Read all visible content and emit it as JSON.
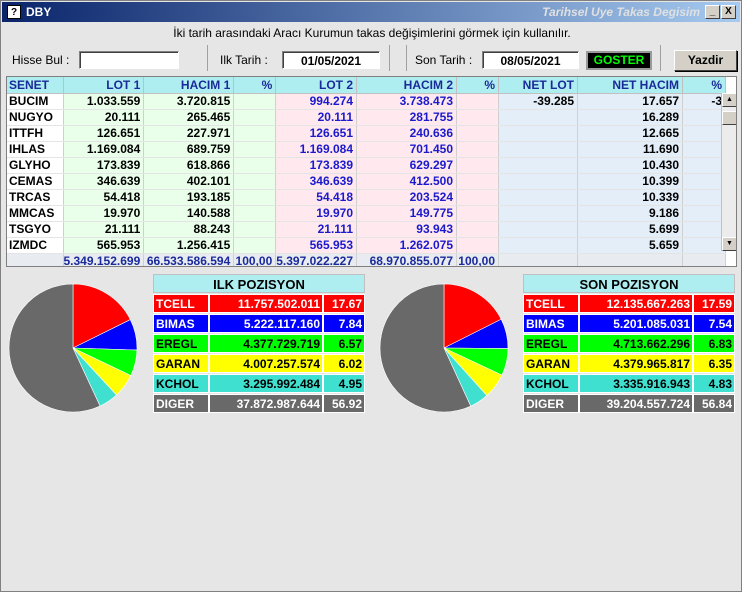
{
  "window": {
    "app_name": "DBY",
    "title": "Tarihsel Uye Takas Degisim",
    "min_glyph": "_",
    "close_glyph": "X"
  },
  "info_text": "İki tarih arasındaki  Aracı Kurumun takas değişimlerini görmek için kullanılır.",
  "toolbar": {
    "hisse_label": "Hisse Bul :",
    "hisse_value": "",
    "ilk_label": "Ilk Tarih :",
    "ilk_value": "01/05/2021",
    "son_label": "Son Tarih :",
    "son_value": "08/05/2021",
    "goster_label": "GOSTER",
    "yazdir_label": "Yazdir"
  },
  "table": {
    "headers": [
      "SENET",
      "LOT 1",
      "HACIM 1",
      "%",
      "LOT 2",
      "HACIM 2",
      "%",
      "NET LOT",
      "NET HACIM",
      "%"
    ],
    "rows": [
      [
        "BUCIM",
        "1.033.559",
        "3.720.815",
        "",
        "994.274",
        "3.738.473",
        "",
        "-39.285",
        "17.657",
        "-3"
      ],
      [
        "NUGYO",
        "20.111",
        "265.465",
        "",
        "20.111",
        "281.755",
        "",
        "",
        "16.289",
        ""
      ],
      [
        "ITTFH",
        "126.651",
        "227.971",
        "",
        "126.651",
        "240.636",
        "",
        "",
        "12.665",
        ""
      ],
      [
        "IHLAS",
        "1.169.084",
        "689.759",
        "",
        "1.169.084",
        "701.450",
        "",
        "",
        "11.690",
        ""
      ],
      [
        "GLYHO",
        "173.839",
        "618.866",
        "",
        "173.839",
        "629.297",
        "",
        "",
        "10.430",
        ""
      ],
      [
        "CEMAS",
        "346.639",
        "402.101",
        "",
        "346.639",
        "412.500",
        "",
        "",
        "10.399",
        ""
      ],
      [
        "TRCAS",
        "54.418",
        "193.185",
        "",
        "54.418",
        "203.524",
        "",
        "",
        "10.339",
        ""
      ],
      [
        "MMCAS",
        "19.970",
        "140.588",
        "",
        "19.970",
        "149.775",
        "",
        "",
        "9.186",
        ""
      ],
      [
        "TSGYO",
        "21.111",
        "88.243",
        "",
        "21.111",
        "93.943",
        "",
        "",
        "5.699",
        ""
      ],
      [
        "IZMDC",
        "565.953",
        "1.256.415",
        "",
        "565.953",
        "1.262.075",
        "",
        "",
        "5.659",
        ""
      ]
    ],
    "totals": [
      "",
      "5.349.152.699",
      "66.533.586.594",
      "100,00",
      "5.397.022.227",
      "68.970.855.077",
      "100,00",
      "",
      "",
      ""
    ]
  },
  "ilk_pozisyon": {
    "title": "ILK POZISYON",
    "items": [
      {
        "name": "TCELL",
        "value": "11.757.502.011",
        "pct": "17.67",
        "pct_num": 17.67,
        "bg": "#ff0000",
        "fg": "#ffffff"
      },
      {
        "name": "BIMAS",
        "value": "5.222.117.160",
        "pct": "7.84",
        "pct_num": 7.84,
        "bg": "#0000ff",
        "fg": "#ffffff"
      },
      {
        "name": "EREGL",
        "value": "4.377.729.719",
        "pct": "6.57",
        "pct_num": 6.57,
        "bg": "#00ff00",
        "fg": "#000000"
      },
      {
        "name": "GARAN",
        "value": "4.007.257.574",
        "pct": "6.02",
        "pct_num": 6.02,
        "bg": "#ffff00",
        "fg": "#000000"
      },
      {
        "name": "KCHOL",
        "value": "3.295.992.484",
        "pct": "4.95",
        "pct_num": 4.95,
        "bg": "#40e0d0",
        "fg": "#000000"
      },
      {
        "name": "DIGER",
        "value": "37.872.987.644",
        "pct": "56.92",
        "pct_num": 56.92,
        "bg": "#696969",
        "fg": "#ffffff"
      }
    ]
  },
  "son_pozisyon": {
    "title": "SON POZISYON",
    "items": [
      {
        "name": "TCELL",
        "value": "12.135.667.263",
        "pct": "17.59",
        "pct_num": 17.59,
        "bg": "#ff0000",
        "fg": "#ffffff"
      },
      {
        "name": "BIMAS",
        "value": "5.201.085.031",
        "pct": "7.54",
        "pct_num": 7.54,
        "bg": "#0000ff",
        "fg": "#ffffff"
      },
      {
        "name": "EREGL",
        "value": "4.713.662.296",
        "pct": "6.83",
        "pct_num": 6.83,
        "bg": "#00ff00",
        "fg": "#000000"
      },
      {
        "name": "GARAN",
        "value": "4.379.965.817",
        "pct": "6.35",
        "pct_num": 6.35,
        "bg": "#ffff00",
        "fg": "#000000"
      },
      {
        "name": "KCHOL",
        "value": "3.335.916.943",
        "pct": "4.83",
        "pct_num": 4.83,
        "bg": "#40e0d0",
        "fg": "#000000"
      },
      {
        "name": "DIGER",
        "value": "39.204.557.724",
        "pct": "56.84",
        "pct_num": 56.84,
        "bg": "#696969",
        "fg": "#ffffff"
      }
    ]
  },
  "icons": [
    "app-icon",
    "minimize-icon",
    "close-icon",
    "scroll-up-icon",
    "scroll-down-icon"
  ]
}
